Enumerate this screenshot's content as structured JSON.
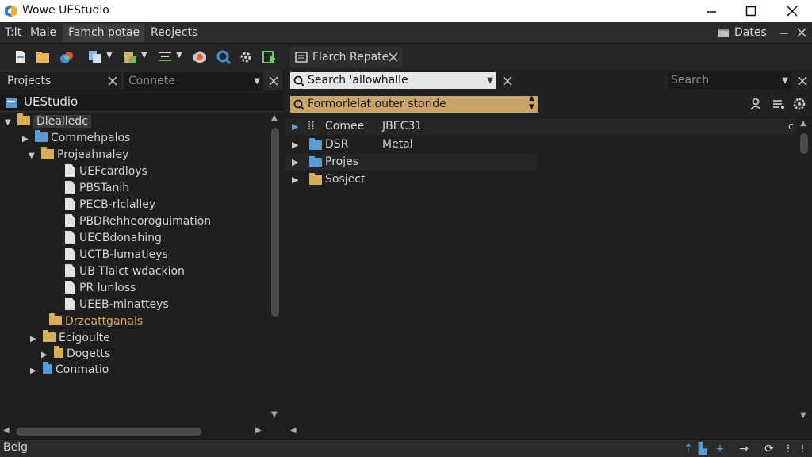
{
  "window": {
    "title": "Wowe UEStudio"
  },
  "menu": {
    "items": [
      "T:lt",
      "Male",
      "Famch potae",
      "Reojects"
    ],
    "right_label": "Dates"
  },
  "left": {
    "tabs": {
      "projects_label": "Projects",
      "second_placeholder": "Connete"
    },
    "root_label": "UEStudio",
    "tree": [
      {
        "label": "Dlealledc"
      },
      {
        "label": "Commehpalos"
      },
      {
        "label": "Projeahnaley"
      },
      {
        "label": "UEFcardloys"
      },
      {
        "label": "PBSTanih"
      },
      {
        "label": "PECB-rlclalley"
      },
      {
        "label": "PBDRehheoroguimation"
      },
      {
        "label": "UECBdonahing"
      },
      {
        "label": "UCTB-lumatleys"
      },
      {
        "label": "UB Tlalct wdackion"
      },
      {
        "label": "PR lunloss"
      },
      {
        "label": "UEEB-minatteys"
      },
      {
        "label": "Drzeattganals"
      },
      {
        "label": "Ecigoulte"
      },
      {
        "label": "Dogetts"
      },
      {
        "label": "Conmatio"
      }
    ]
  },
  "right": {
    "tab_label": "Flarch Repate",
    "search_value": "Search 'allowhalle",
    "search2_placeholder": "Search",
    "filter_value": "Formorlelat outer storide",
    "rows": [
      {
        "name": "Comee",
        "extra": "JBEC31"
      },
      {
        "name": "DSR",
        "extra": "Metal"
      },
      {
        "name": "Projes",
        "extra": ""
      },
      {
        "name": "Sosject",
        "extra": ""
      }
    ]
  },
  "status": {
    "text": "Belg"
  }
}
